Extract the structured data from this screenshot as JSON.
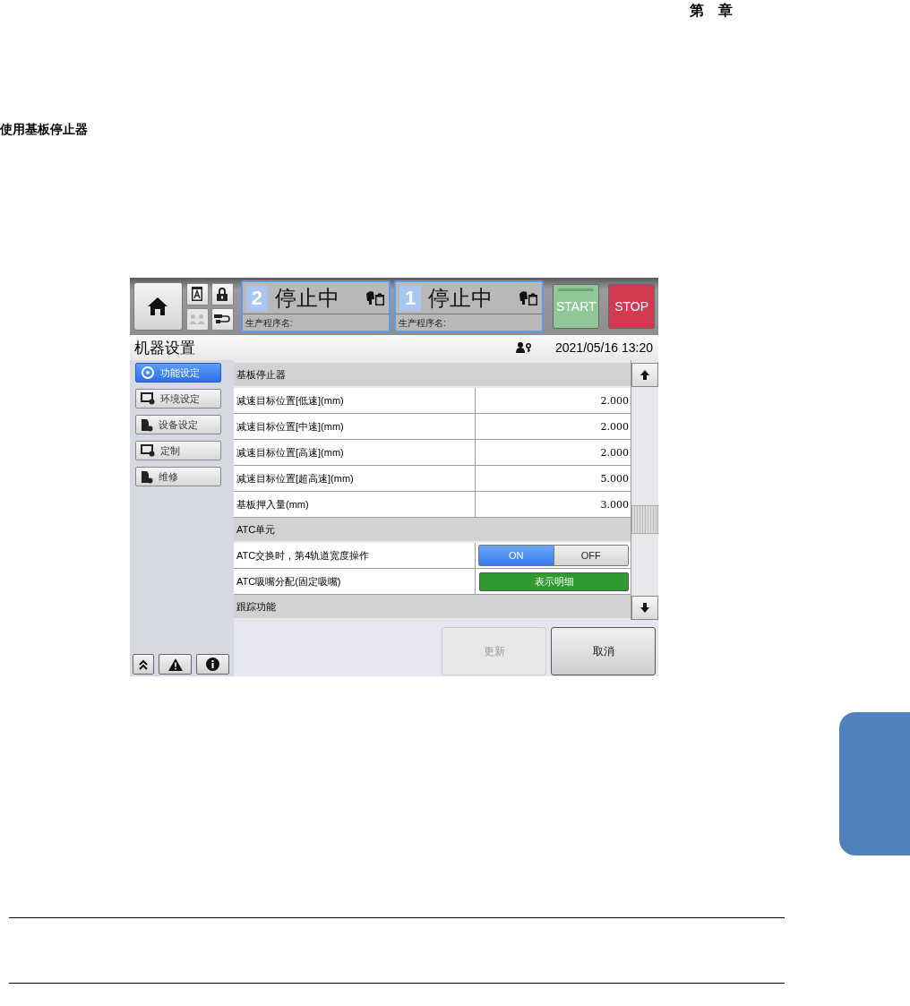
{
  "page": {
    "chapter": "第　章",
    "heading": "使用基板停止器"
  },
  "screen": {
    "toolbar": {
      "lanes": [
        {
          "number": "2",
          "status": "停止中",
          "program_label": "生产程序名:"
        },
        {
          "number": "1",
          "status": "停止中",
          "program_label": "生产程序名:"
        }
      ],
      "start": "START",
      "stop": "STOP"
    },
    "title": "机器设置",
    "datetime": "2021/05/16 13:20",
    "sidebar": {
      "items": [
        {
          "label": "功能设定",
          "selected": true
        },
        {
          "label": "环境设定",
          "selected": false
        },
        {
          "label": "设备设定",
          "selected": false
        },
        {
          "label": "定制",
          "selected": false
        },
        {
          "label": "维修",
          "selected": false
        }
      ]
    },
    "sections": [
      {
        "title": "基板停止器",
        "rows": [
          {
            "kind": "value",
            "label": "减速目标位置[低速](mm)",
            "value": "2.000"
          },
          {
            "kind": "value",
            "label": "减速目标位置[中速](mm)",
            "value": "2.000"
          },
          {
            "kind": "value",
            "label": "减速目标位置[高速](mm)",
            "value": "2.000"
          },
          {
            "kind": "value",
            "label": "减速目标位置[超高速](mm)",
            "value": "5.000"
          },
          {
            "kind": "value",
            "label": "基板押入量(mm)",
            "value": "3.000"
          }
        ]
      },
      {
        "title": "ATC单元",
        "rows": [
          {
            "kind": "toggle",
            "label": "ATC交换时，第4轨道宽度操作",
            "on_label": "ON",
            "off_label": "OFF",
            "on": true
          },
          {
            "kind": "button",
            "label": "ATC吸嘴分配(固定吸嘴)",
            "button": "表示明细"
          }
        ]
      },
      {
        "title": "跟踪功能"
      }
    ],
    "buttons": [
      {
        "label": "更新",
        "disabled": true
      },
      {
        "label": "取消",
        "disabled": false
      }
    ]
  }
}
